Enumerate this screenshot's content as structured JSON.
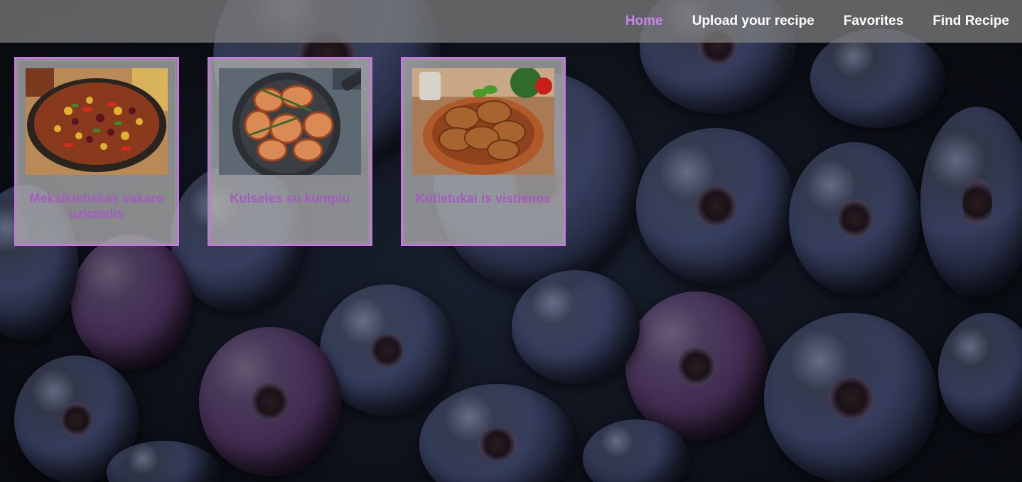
{
  "nav": {
    "items": [
      {
        "label": "Home",
        "active": true
      },
      {
        "label": "Upload your recipe",
        "active": false
      },
      {
        "label": "Favorites",
        "active": false
      },
      {
        "label": "Find Recipe",
        "active": false
      }
    ]
  },
  "recipes": [
    {
      "title": "Meksikietiskas vakaro uzkandis",
      "image_icon": "chili-pan-image"
    },
    {
      "title": "Kulseles su kumpiu",
      "image_icon": "bacon-wrapped-chicken-image"
    },
    {
      "title": "Kotletukai is vistienos",
      "image_icon": "chicken-patties-image"
    }
  ],
  "colors": {
    "accent": "#c986e8",
    "card_title": "#a25dbd",
    "card_border": "#c07ad8"
  }
}
